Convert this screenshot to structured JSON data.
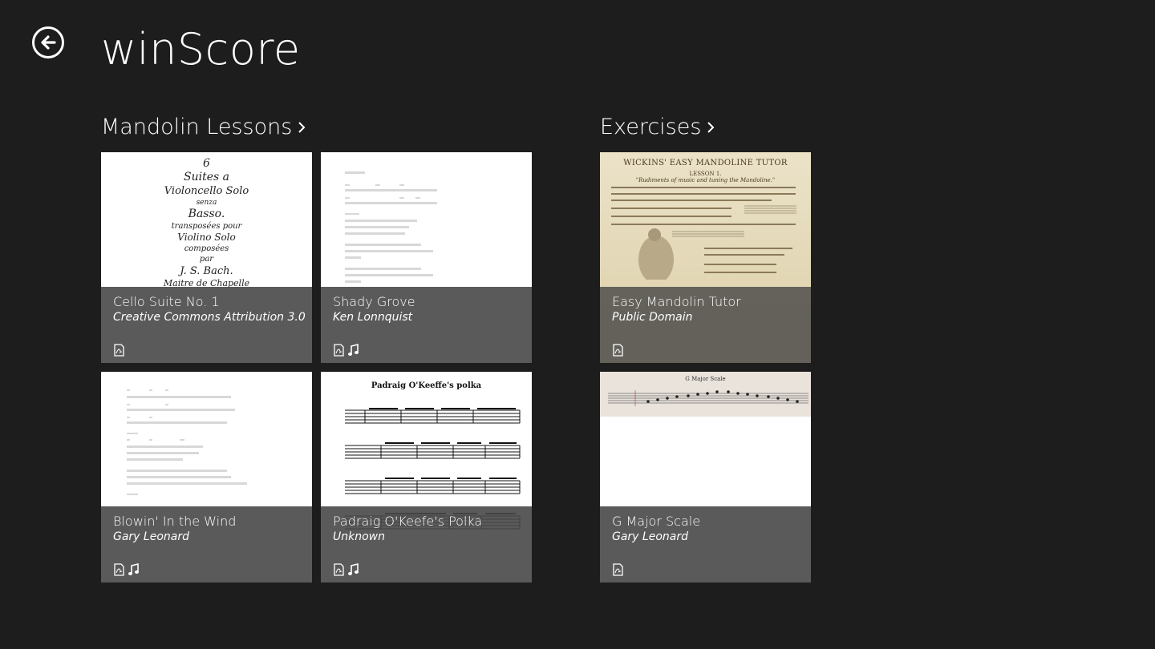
{
  "app": {
    "title": "winScore"
  },
  "groups": [
    {
      "header": "Mandolin Lessons",
      "tiles": [
        {
          "title": "Cello Suite No. 1",
          "subtitle": "Creative Commons Attribution 3.0",
          "icons": [
            "pdf-icon"
          ],
          "thumb_text": [
            "6",
            "Suites a",
            "Violoncello Solo",
            "senza",
            "Basso.",
            "transposées pour",
            "Violino Solo",
            "composées",
            "par",
            "J. S. Bach.",
            "Maitre de Chapelle"
          ]
        },
        {
          "title": "Shady Grove",
          "subtitle": "Ken Lonnquist",
          "icons": [
            "pdf-icon",
            "music-note-icon"
          ]
        },
        {
          "title": "Blowin' In the Wind",
          "subtitle": "Gary Leonard",
          "icons": [
            "pdf-icon",
            "music-note-icon"
          ]
        },
        {
          "title": "Padraig O'Keefe's Polka",
          "subtitle": "Unknown",
          "icons": [
            "pdf-icon",
            "music-note-icon"
          ],
          "thumb_text": [
            "Padraig O'Keeffe's polka"
          ]
        }
      ]
    },
    {
      "header": "Exercises",
      "tiles": [
        {
          "title": "Easy Mandolin Tutor",
          "subtitle": "Public Domain",
          "icons": [
            "pdf-icon"
          ],
          "thumb_text": [
            "WICKINS' EASY MANDOLINE TUTOR",
            "LESSON 1.",
            "\"Rudiments of music and tuning the Mandoline.\""
          ]
        },
        {
          "title": "G Major Scale",
          "subtitle": "Gary Leonard",
          "icons": [
            "pdf-icon"
          ],
          "thumb_text": [
            "G Major Scale"
          ]
        }
      ]
    }
  ],
  "colors": {
    "background": "#1d1d1d",
    "overlay": "#484848",
    "text": "#ffffff"
  },
  "icon_names": {
    "back": "back-arrow-icon",
    "chevron": "chevron-right-icon",
    "pdf": "pdf-icon",
    "music": "music-note-icon"
  }
}
